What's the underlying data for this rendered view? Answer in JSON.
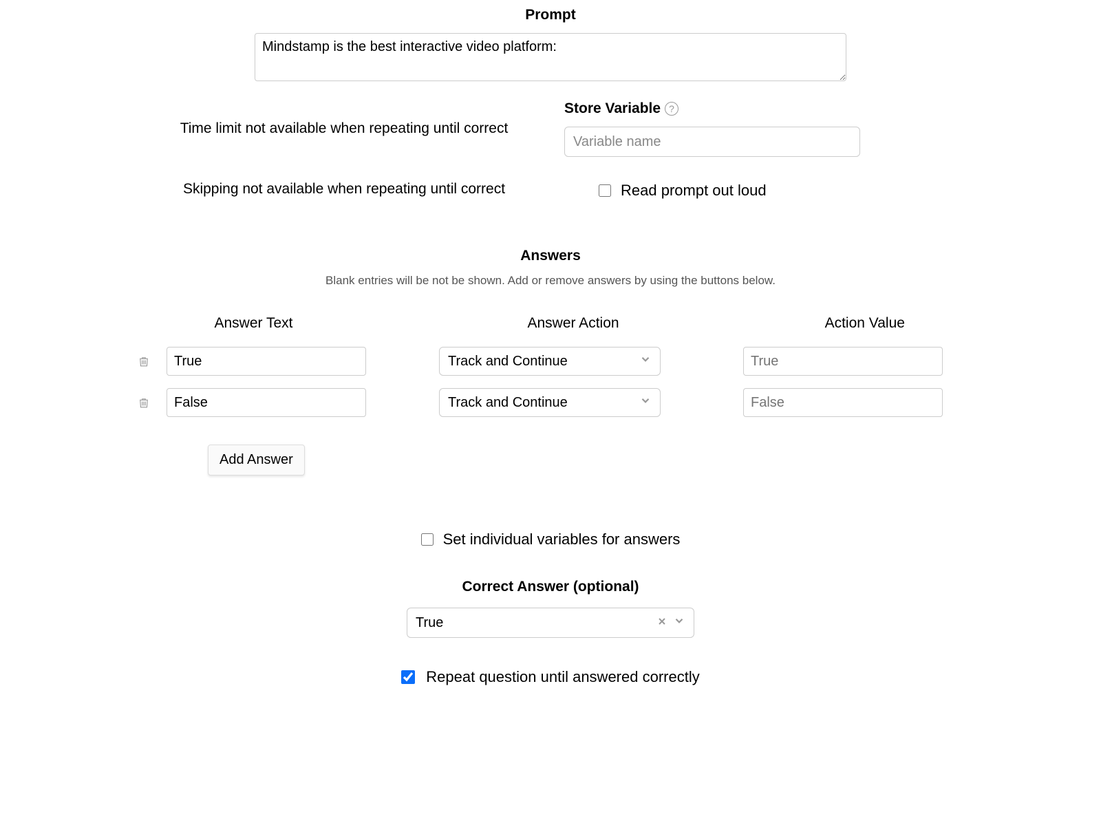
{
  "prompt": {
    "label": "Prompt",
    "value": "Mindstamp is the best interactive video platform:"
  },
  "time_limit_note": "Time limit not available when repeating until correct",
  "skipping_note": "Skipping not available when repeating until correct",
  "store_variable": {
    "label": "Store Variable",
    "placeholder": "Variable name"
  },
  "read_aloud": {
    "label": "Read prompt out loud",
    "checked": false
  },
  "answers_section": {
    "title": "Answers",
    "subtitle": "Blank entries will be not be shown. Add or remove answers by using the buttons below.",
    "headers": {
      "text": "Answer Text",
      "action": "Answer Action",
      "value": "Action Value"
    },
    "rows": [
      {
        "text": "True",
        "action": "Track and Continue",
        "value": "True"
      },
      {
        "text": "False",
        "action": "Track and Continue",
        "value": "False"
      }
    ],
    "add_button": "Add Answer"
  },
  "individual_vars": {
    "label": "Set individual variables for answers",
    "checked": false
  },
  "correct_answer": {
    "label": "Correct Answer (optional)",
    "value": "True"
  },
  "repeat": {
    "label": "Repeat question until answered correctly",
    "checked": true
  }
}
